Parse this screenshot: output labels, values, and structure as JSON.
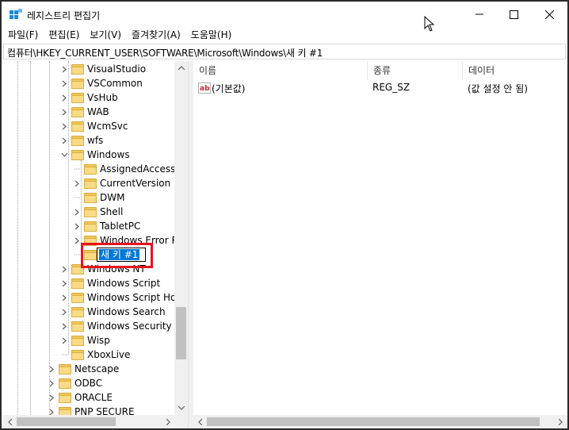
{
  "window": {
    "title": "레지스트리 편집기"
  },
  "menu": [
    "파일(F)",
    "편집(E)",
    "보기(V)",
    "즐겨찾기(A)",
    "도움말(H)"
  ],
  "address": "컴퓨터\\HKEY_CURRENT_USER\\SOFTWARE\\Microsoft\\Windows\\새 키 #1",
  "tree": {
    "items": [
      {
        "label": "VisualStudio",
        "expandable": true
      },
      {
        "label": "VSCommon",
        "expandable": true
      },
      {
        "label": "VsHub",
        "expandable": true
      },
      {
        "label": "WAB",
        "expandable": true
      },
      {
        "label": "WcmSvc",
        "expandable": true
      },
      {
        "label": "wfs",
        "expandable": true
      },
      {
        "label": "Windows",
        "expanded": true
      },
      {
        "label": "AssignedAccessC",
        "expandable": false
      },
      {
        "label": "CurrentVersion",
        "expandable": true
      },
      {
        "label": "DWM",
        "expandable": false
      },
      {
        "label": "Shell",
        "expandable": true
      },
      {
        "label": "TabletPC",
        "expandable": true
      },
      {
        "label": "Windows Error Re",
        "expandable": true
      },
      {
        "label": "새 키 #1",
        "editing": true
      },
      {
        "label": "Windows NT",
        "expandable": true
      },
      {
        "label": "Windows Script",
        "expandable": true
      },
      {
        "label": "Windows Script Hos",
        "expandable": true
      },
      {
        "label": "Windows Search",
        "expandable": true
      },
      {
        "label": "Windows Security H",
        "expandable": true
      },
      {
        "label": "Wisp",
        "expandable": true
      },
      {
        "label": "XboxLive",
        "expandable": false
      },
      {
        "label": "Netscape",
        "expandable": true
      },
      {
        "label": "ODBC",
        "expandable": true
      },
      {
        "label": "ORACLE",
        "expandable": true
      },
      {
        "label": "PNP SECURE",
        "expandable": true
      }
    ]
  },
  "list": {
    "columns": [
      "이름",
      "종류",
      "데이터"
    ],
    "rows": [
      {
        "name": "(기본값)",
        "type": "REG_SZ",
        "data": "(값 설정 안 됨)"
      }
    ]
  },
  "colors": {
    "highlight": "#e8141e",
    "selection": "#0078d7",
    "folder": "#f8db86"
  }
}
